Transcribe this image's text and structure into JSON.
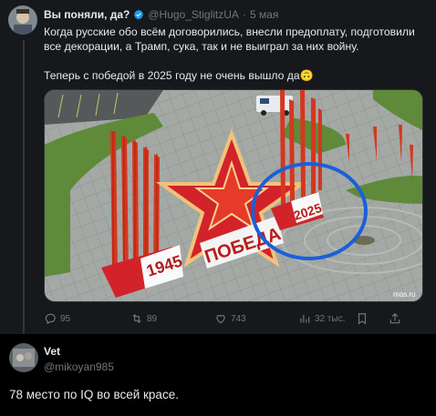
{
  "post": {
    "author_name": "Вы поняли, да?",
    "handle": "@Hugo_StiglitzUA",
    "separator": "·",
    "date": "5 мая",
    "text_line1": "Когда русские обо всём договорились, внесли предоплату, подготовили",
    "text_line2": "все декорации, а Трамп, сука, так и не выиграл за них войну.",
    "text_line3": "Теперь с победой в 2025 году не очень вышло да",
    "emoji": "🙃",
    "media": {
      "sign_year_1945": "1945",
      "sign_word": "ПОБЕДА",
      "sign_year_2025": "2025",
      "watermark": "mos.ru"
    },
    "stats": {
      "replies": "95",
      "reposts": "89",
      "likes": "743",
      "views": "32 тыс."
    }
  },
  "reply": {
    "author_name": "Vet",
    "handle": "@mikoyan985",
    "text": "78 место по IQ во всей красе."
  },
  "colors": {
    "accent_blue": "#1d9bf0",
    "background": "#000000",
    "card": "#16181c",
    "muted": "#71767b",
    "highlight_circle": "#1a5fd9"
  }
}
